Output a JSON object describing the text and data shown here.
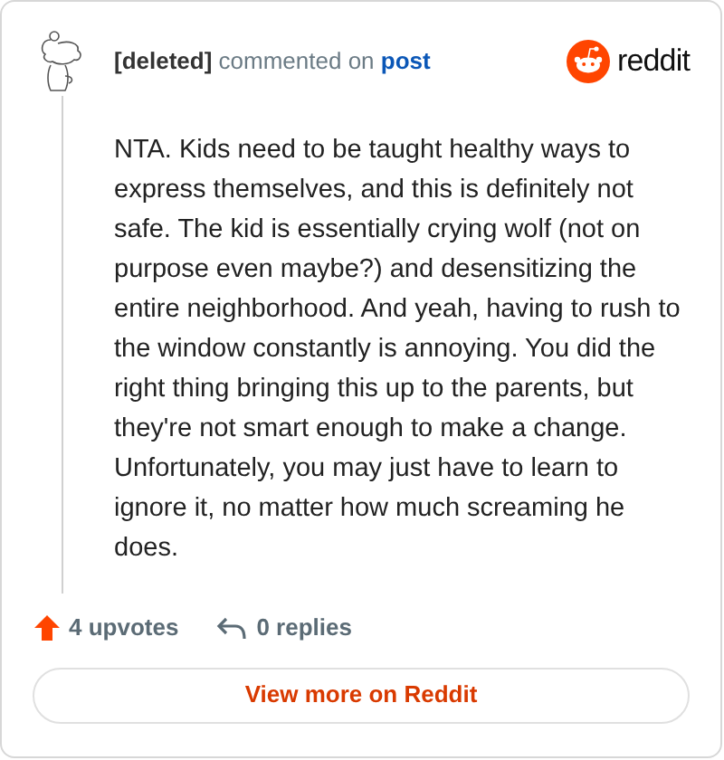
{
  "comment": {
    "author": "[deleted]",
    "action": "commented on",
    "target": "post",
    "body": "NTA. Kids need to be taught healthy ways to express themselves, and this is definitely not safe. The kid is essentially crying wolf (not on purpose even maybe?) and desensitizing the entire neighborhood. And yeah, having to rush to the window constantly is annoying. You did the right thing bringing this up to the parents, but they're not smart enough to make a change. Unfortunately, you may just have to learn to ignore it, no matter how much screaming he does."
  },
  "brand": "reddit",
  "stats": {
    "upvotes": "4 upvotes",
    "replies": "0 replies"
  },
  "button": "View more on Reddit"
}
